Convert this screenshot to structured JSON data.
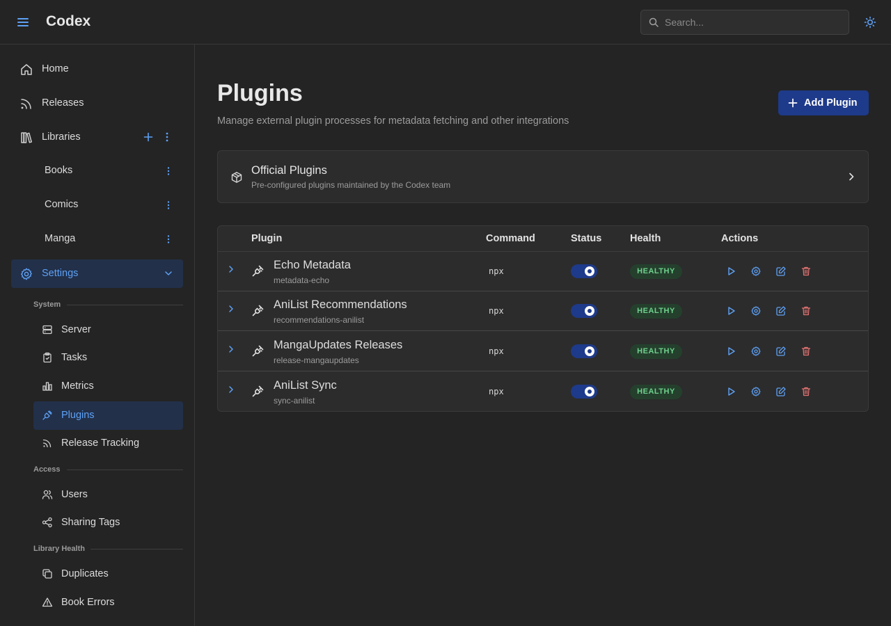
{
  "header": {
    "brand": "Codex",
    "search_placeholder": "Search..."
  },
  "sidebar": {
    "home": "Home",
    "releases": "Releases",
    "libraries": "Libraries",
    "library_items": [
      "Books",
      "Comics",
      "Manga"
    ],
    "settings": "Settings",
    "sections": {
      "system": "System",
      "access": "Access",
      "library_health": "Library Health"
    },
    "system_items": [
      "Server",
      "Tasks",
      "Metrics",
      "Plugins",
      "Release Tracking"
    ],
    "access_items": [
      "Users",
      "Sharing Tags"
    ],
    "health_items": [
      "Duplicates",
      "Book Errors"
    ]
  },
  "main": {
    "title": "Plugins",
    "description": "Manage external plugin processes for metadata fetching and other integrations",
    "add_button": "Add Plugin",
    "official": {
      "title": "Official Plugins",
      "subtitle": "Pre-configured plugins maintained by the Codex team"
    },
    "table": {
      "headers": {
        "plugin": "Plugin",
        "command": "Command",
        "status": "Status",
        "health": "Health",
        "actions": "Actions"
      },
      "rows": [
        {
          "name": "Echo Metadata",
          "id": "metadata-echo",
          "command": "npx",
          "enabled": true,
          "health": "HEALTHY"
        },
        {
          "name": "AniList Recommendations",
          "id": "recommendations-anilist",
          "command": "npx",
          "enabled": true,
          "health": "HEALTHY"
        },
        {
          "name": "MangaUpdates Releases",
          "id": "release-mangaupdates",
          "command": "npx",
          "enabled": true,
          "health": "HEALTHY"
        },
        {
          "name": "AniList Sync",
          "id": "sync-anilist",
          "command": "npx",
          "enabled": true,
          "health": "HEALTHY"
        }
      ]
    }
  },
  "colors": {
    "accent": "#5ea1f5",
    "primary_button": "#1e3a8a",
    "healthy_text": "#6fd08c",
    "danger": "#e57373"
  }
}
